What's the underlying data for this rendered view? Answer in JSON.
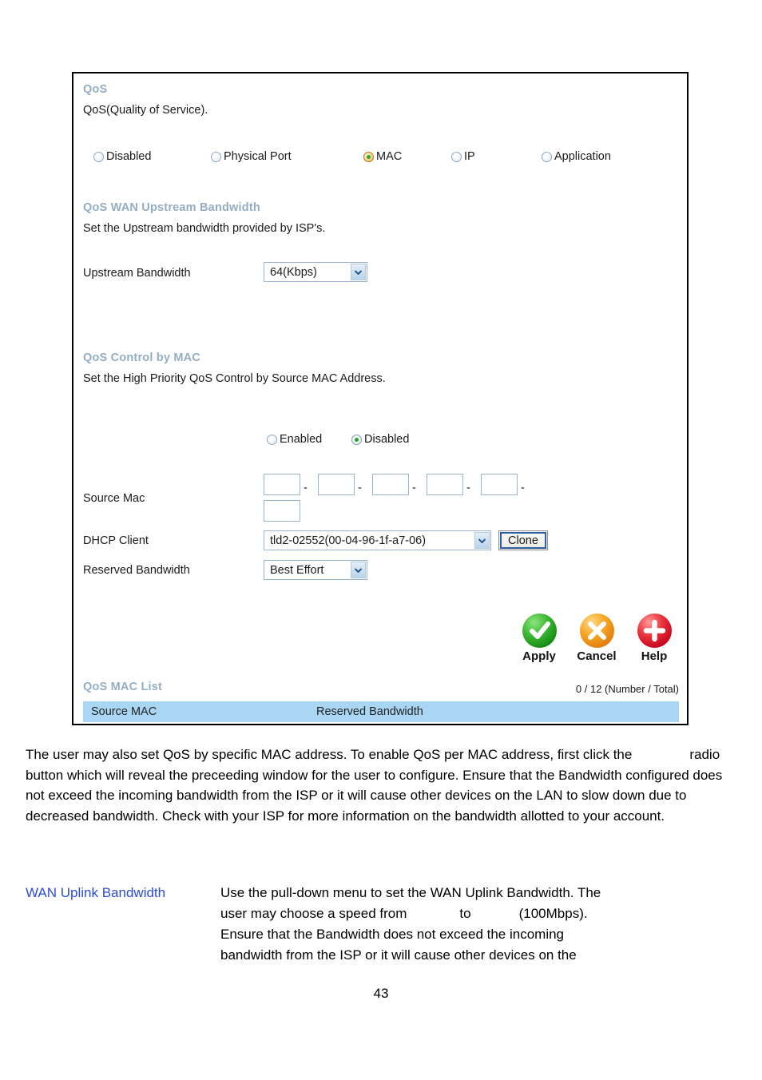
{
  "panel": {
    "qos": {
      "heading": "QoS",
      "description": "QoS(Quality of Service).",
      "mode_options": [
        {
          "label": "Disabled",
          "selected": false
        },
        {
          "label": "Physical Port",
          "selected": false
        },
        {
          "label": "MAC",
          "selected": true
        },
        {
          "label": "IP",
          "selected": false
        },
        {
          "label": "Application",
          "selected": false
        }
      ]
    },
    "upstream": {
      "heading": "QoS WAN Upstream Bandwidth",
      "description": "Set the Upstream bandwidth provided by ISP's.",
      "field_label": "Upstream Bandwidth",
      "value": "64(Kbps)"
    },
    "control_by_mac": {
      "heading": "QoS Control by MAC",
      "description": "Set the High Priority QoS Control by Source MAC Address.",
      "toggle_options": [
        {
          "label": "Enabled",
          "selected": false
        },
        {
          "label": "Disabled",
          "selected": true
        }
      ],
      "source_mac_label": "Source Mac",
      "source_mac_octets": [
        "",
        "",
        "",
        "",
        "",
        ""
      ],
      "octet_separator": "-",
      "dhcp_client_label": "DHCP Client",
      "dhcp_client_value": "tld2-02552(00-04-96-1f-a7-06)",
      "clone_button": "Clone",
      "reserved_bandwidth_label": "Reserved Bandwidth",
      "reserved_bandwidth_value": "Best Effort"
    },
    "actions": [
      {
        "label": "Apply",
        "icon": "check-circle-icon",
        "color": "#2aa62a"
      },
      {
        "label": "Cancel",
        "icon": "cross-circle-icon",
        "color": "#f0890f"
      },
      {
        "label": "Help",
        "icon": "plus-circle-icon",
        "color": "#d6121f"
      }
    ],
    "mac_list": {
      "heading": "QoS MAC List",
      "count": "0 / 12 (Number / Total)",
      "columns": [
        "Source MAC",
        "Reserved Bandwidth"
      ],
      "header_color": "#a9d6f3"
    }
  },
  "body": {
    "paragraph": {
      "part1": "The user may also set QoS by specific MAC address. To enable QoS per MAC address, first click the",
      "part2": "radio button which will reveal the preceeding window for the user to configure. Ensure that the Bandwidth configured does not exceed the incoming bandwidth from the ISP or it will cause other devices on the LAN to slow down due to decreased bandwidth. Check with your ISP for more information on the bandwidth allotted to your account."
    },
    "definition": {
      "term": "WAN Uplink Bandwidth",
      "term_color": "#2b4cd6",
      "line1": "Use the pull-down menu to set the WAN Uplink Bandwidth. The",
      "line2a": "user may choose a speed from",
      "line2b": "to",
      "line2c": "(100Mbps).",
      "line3": "Ensure that the Bandwidth does not exceed the incoming",
      "line4": "bandwidth from the ISP or it will cause other devices on the"
    },
    "page_number": "43"
  }
}
